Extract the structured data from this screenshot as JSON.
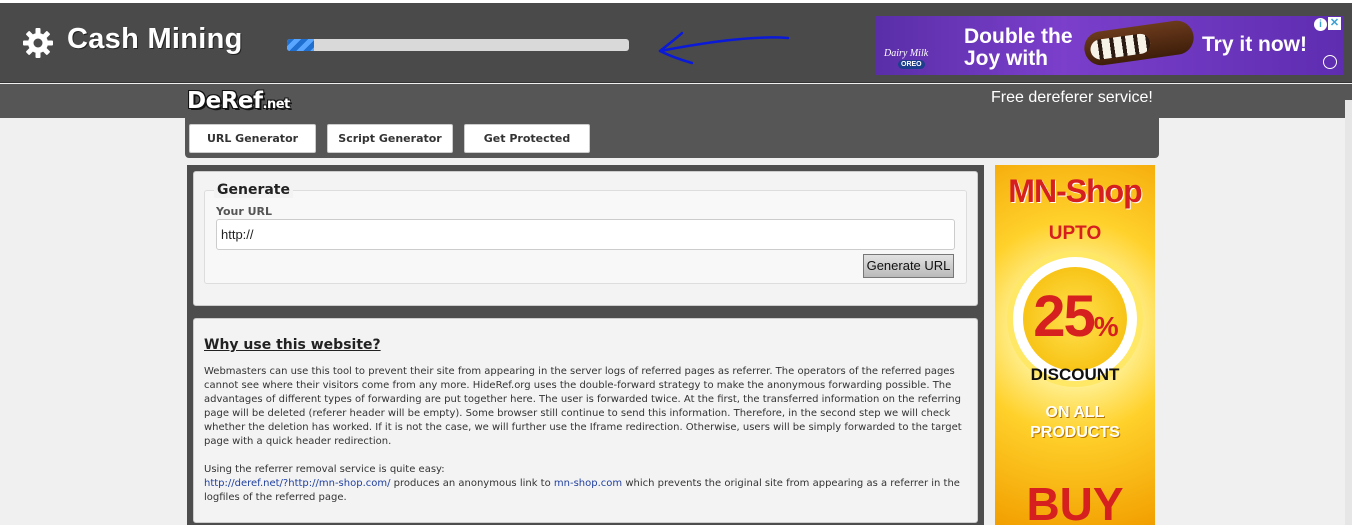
{
  "miner": {
    "title": "Cash Mining",
    "progress": 0.08
  },
  "top_ad": {
    "brand": "Dairy Milk",
    "sub_brand": "OREO",
    "headline": "Double the Joy with",
    "cta": "Try it now!",
    "info_icon": "info-icon",
    "close_icon": "close-icon"
  },
  "site": {
    "logo": "DeRef",
    "logo_suffix": ".net",
    "tagline": "Free dereferer service!"
  },
  "nav": {
    "items": [
      {
        "label": "URL Generator"
      },
      {
        "label": "Script Generator"
      },
      {
        "label": "Get Protected"
      }
    ]
  },
  "generate": {
    "legend": "Generate",
    "field_label": "Your URL",
    "field_value": "http://",
    "button_label": "Generate URL"
  },
  "why": {
    "title": "Why use this website?",
    "paragraph": "Webmasters can use this tool to prevent their site from appearing in the server logs of referred pages as referrer. The operators of the referred pages cannot see where their visitors come from any more. HideRef.org uses the double-forward strategy to make the anonymous forwarding possible. The advantages of different types of forwarding are put together here. The user is forwarded twice. At the first, the transferred information on the referring page will be deleted (referer header will be empty). Some browser still continue to send this information. Therefore, in the second step we will check whether the deletion has worked. If it is not the case, we will further use the Iframe redirection. Otherwise, users will be simply forwarded to the target page with a quick header redirection.",
    "usage_intro": "Using the referrer removal service is quite easy:",
    "example_link": "http://deref.net/?http://mn-shop.com/",
    "example_mid": " produces an anonymous link to ",
    "example_target": "mn-shop.com",
    "example_end": " which prevents the original site from appearing as a referrer in the logfiles of the referred page."
  },
  "side_ad": {
    "shop": "MN-Shop",
    "upto": "UPTO",
    "amount": "25",
    "percent": "%",
    "discount": "DISCOUNT",
    "on_all": "ON ALL",
    "products": "PRODUCTS",
    "buy": "BUY"
  },
  "colors": {
    "topbar": "#4a4a4a",
    "header": "#565656",
    "progress_fill": "#1e6fd0",
    "arrow": "#0a1ad8",
    "ad_purple": "#6a34bd",
    "sale_red": "#d61f1f",
    "sale_yellow": "#ffd12b"
  }
}
